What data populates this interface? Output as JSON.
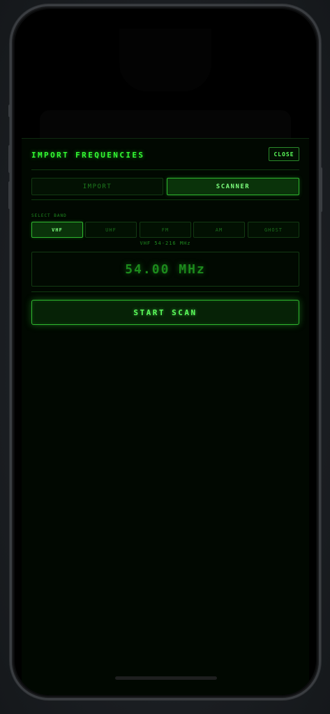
{
  "header": {
    "title": "IMPORT FREQUENCIES",
    "close_label": "CLOSE"
  },
  "tabs": [
    {
      "label": "IMPORT",
      "active": false
    },
    {
      "label": "SCANNER",
      "active": true
    }
  ],
  "scanner": {
    "select_band_label": "SELECT BAND",
    "bands": [
      {
        "label": "VHF",
        "active": true
      },
      {
        "label": "UHF",
        "active": false
      },
      {
        "label": "FM",
        "active": false
      },
      {
        "label": "AM",
        "active": false
      },
      {
        "label": "GHOST",
        "active": false
      }
    ],
    "band_range": "VHF 54-216 MHz",
    "frequency_display": "54.00 MHz",
    "start_scan_label": "START SCAN"
  },
  "colors": {
    "accent": "#33ff33",
    "background": "#010801",
    "border": "#2fb82f"
  }
}
